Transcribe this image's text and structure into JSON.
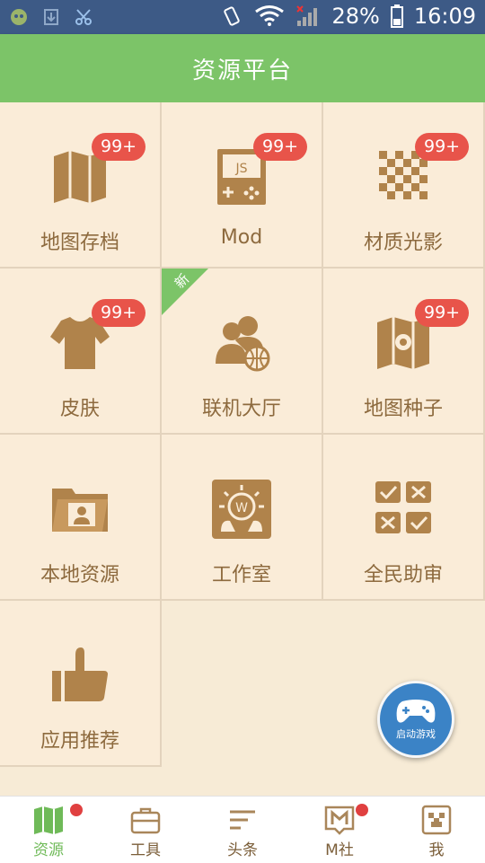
{
  "status_bar": {
    "battery": "28%",
    "time": "16:09"
  },
  "header": {
    "title": "资源平台"
  },
  "tiles": [
    {
      "label": "地图存档",
      "badge": "99+",
      "icon": "map-icon"
    },
    {
      "label": "Mod",
      "badge": "99+",
      "icon": "js-gamepad-icon"
    },
    {
      "label": "材质光影",
      "badge": "99+",
      "icon": "checker-texture-icon"
    },
    {
      "label": "皮肤",
      "badge": "99+",
      "icon": "shirt-icon"
    },
    {
      "label": "联机大厅",
      "ribbon": "新",
      "icon": "multiplayer-globe-icon"
    },
    {
      "label": "地图种子",
      "badge": "99+",
      "icon": "map-seed-icon"
    },
    {
      "label": "本地资源",
      "icon": "folder-user-icon"
    },
    {
      "label": "工作室",
      "icon": "studio-bulb-icon"
    },
    {
      "label": "全民助审",
      "icon": "review-checks-icon"
    },
    {
      "label": "应用推荐",
      "icon": "thumbs-up-icon"
    }
  ],
  "launch_button": {
    "label": "启动游戏"
  },
  "bottom_nav": [
    {
      "label": "资源",
      "active": true,
      "dot": true
    },
    {
      "label": "工具"
    },
    {
      "label": "头条"
    },
    {
      "label": "M社",
      "dot": true
    },
    {
      "label": "我"
    }
  ],
  "colors": {
    "header": "#7cc468",
    "background": "#f7ebd6",
    "icon": "#b0834b",
    "badge": "#e8544a",
    "accent_blue": "#3b83c6",
    "status_bar": "#3d5a86"
  }
}
